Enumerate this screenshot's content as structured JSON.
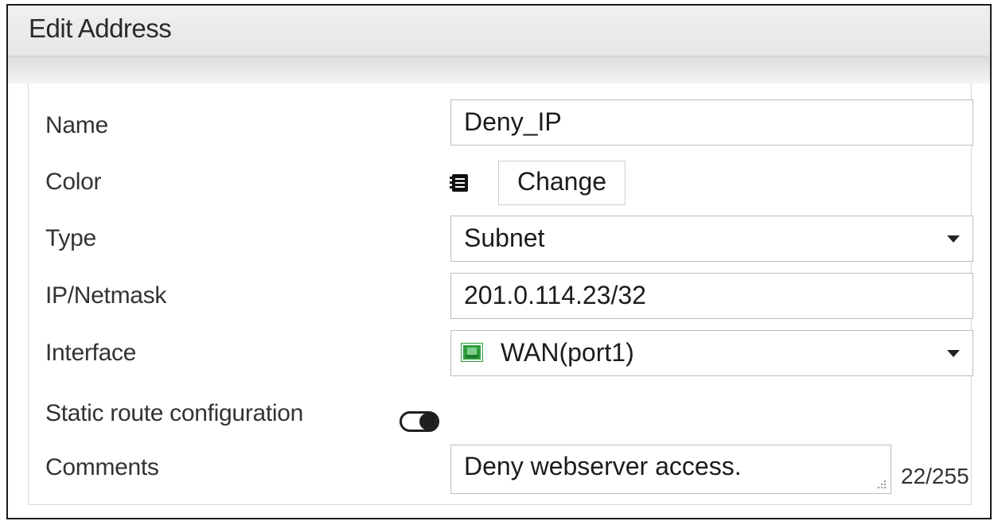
{
  "dialog": {
    "title": "Edit Address"
  },
  "form": {
    "name": {
      "label": "Name",
      "value": "Deny_IP"
    },
    "color": {
      "label": "Color",
      "button_label": "Change"
    },
    "type": {
      "label": "Type",
      "selected": "Subnet"
    },
    "ip_netmask": {
      "label": "IP/Netmask",
      "value": "201.0.114.23/32"
    },
    "interface": {
      "label": "Interface",
      "selected": "WAN(port1)",
      "icon": "network-port-icon"
    },
    "static_route": {
      "label": "Static route configuration",
      "enabled": false
    },
    "comments": {
      "label": "Comments",
      "value": "Deny webserver access.",
      "counter": "22/255"
    }
  },
  "colors": {
    "interface_icon": "#2e9e3e",
    "toggle_knob": "#1f1f1f"
  }
}
